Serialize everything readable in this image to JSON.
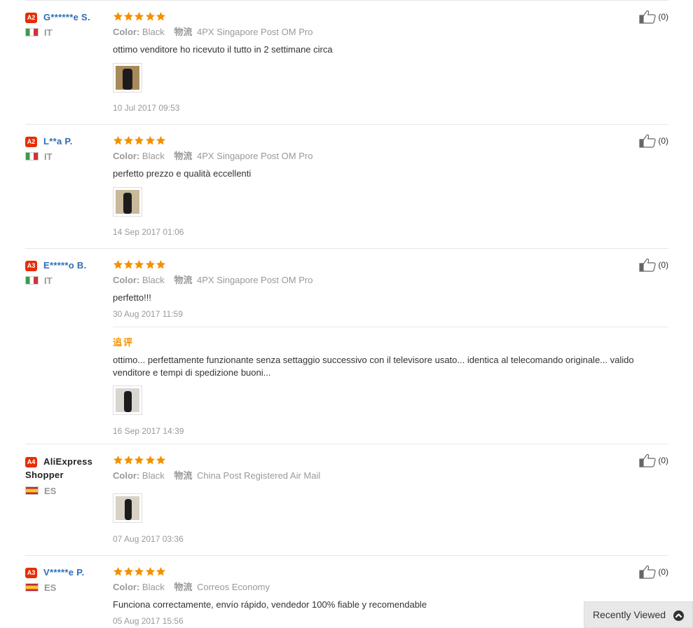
{
  "colors": {
    "badge": "#e62e04",
    "username": "#2c6eb5",
    "star": "#f29100",
    "followup": "#f29100",
    "muted": "#999999"
  },
  "reviews": [
    {
      "level": "A2",
      "name": "G******e S.",
      "country_code": "IT",
      "flag": "italy-flag",
      "rating": 5,
      "color_label": "Color:",
      "color_value": "Black",
      "logistics_label": "物流",
      "logistics_value": "4PX Singapore Post OM Pro",
      "text": "ottimo venditore ho ricevuto il tutto in 2 settimane circa",
      "date": "10 Jul 2017 09:53",
      "helpful": "(0)"
    },
    {
      "level": "A2",
      "name": "L**a P.",
      "country_code": "IT",
      "flag": "italy-flag",
      "rating": 5,
      "color_label": "Color:",
      "color_value": "Black",
      "logistics_label": "物流",
      "logistics_value": "4PX Singapore Post OM Pro",
      "text": "perfetto prezzo e qualità eccellenti",
      "date": "14 Sep 2017 01:06",
      "helpful": "(0)"
    },
    {
      "level": "A3",
      "name": "E*****o B.",
      "country_code": "IT",
      "flag": "italy-flag",
      "rating": 5,
      "color_label": "Color:",
      "color_value": "Black",
      "logistics_label": "物流",
      "logistics_value": "4PX Singapore Post OM Pro",
      "text": "perfetto!!!",
      "date": "30 Aug 2017 11:59",
      "helpful": "(0)",
      "followup": {
        "label": "追评",
        "text": "ottimo... perfettamente funzionante senza settaggio successivo con il televisore usato... identica al telecomando originale... valido venditore e tempi di spedizione buoni...",
        "date": "16 Sep 2017 14:39"
      }
    },
    {
      "level": "A4",
      "name": "AliExpress Shopper",
      "name_line1": "AliExpress",
      "name_line2": "Shopper",
      "country_code": "ES",
      "flag": "spain-flag",
      "rating": 5,
      "color_label": "Color:",
      "color_value": "Black",
      "logistics_label": "物流",
      "logistics_value": "China Post Registered Air Mail",
      "date": "07 Aug 2017 03:36",
      "helpful": "(0)"
    },
    {
      "level": "A3",
      "name": "V*****e P.",
      "country_code": "ES",
      "flag": "spain-flag",
      "rating": 5,
      "color_label": "Color:",
      "color_value": "Black",
      "logistics_label": "物流",
      "logistics_value": "Correos Economy",
      "text": "Funciona correctamente, envío rápido, vendedor 100% fiable y recomendable",
      "date": "05 Aug 2017 15:56",
      "helpful": "(0)"
    }
  ],
  "recently_viewed": {
    "label": "Recently Viewed",
    "icon": "chevron-up-circle-icon"
  }
}
